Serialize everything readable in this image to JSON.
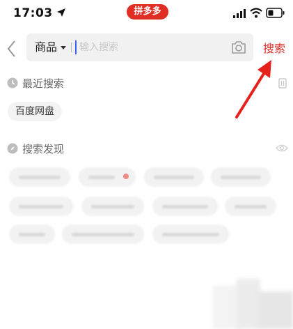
{
  "status_bar": {
    "time": "17:03",
    "brand_badge": "拼多多"
  },
  "search": {
    "scope_label": "商品",
    "input_value": "",
    "placeholder": "输入搜索",
    "submit_label": "搜索"
  },
  "recent": {
    "title": "最近搜索",
    "items": [
      "百度网盘"
    ]
  },
  "discover": {
    "title": "搜索发现",
    "items_obscured": true,
    "item_count": 11
  },
  "colors": {
    "brand_red": "#e02e24",
    "cursor_blue": "#3e5fff",
    "search_bg": "#f1f1f1"
  },
  "icons": [
    "location-arrow-icon",
    "signal-icon",
    "wifi-icon",
    "battery-icon",
    "back-icon",
    "camera-icon",
    "clock-icon",
    "trash-icon",
    "compass-icon",
    "eye-icon"
  ]
}
